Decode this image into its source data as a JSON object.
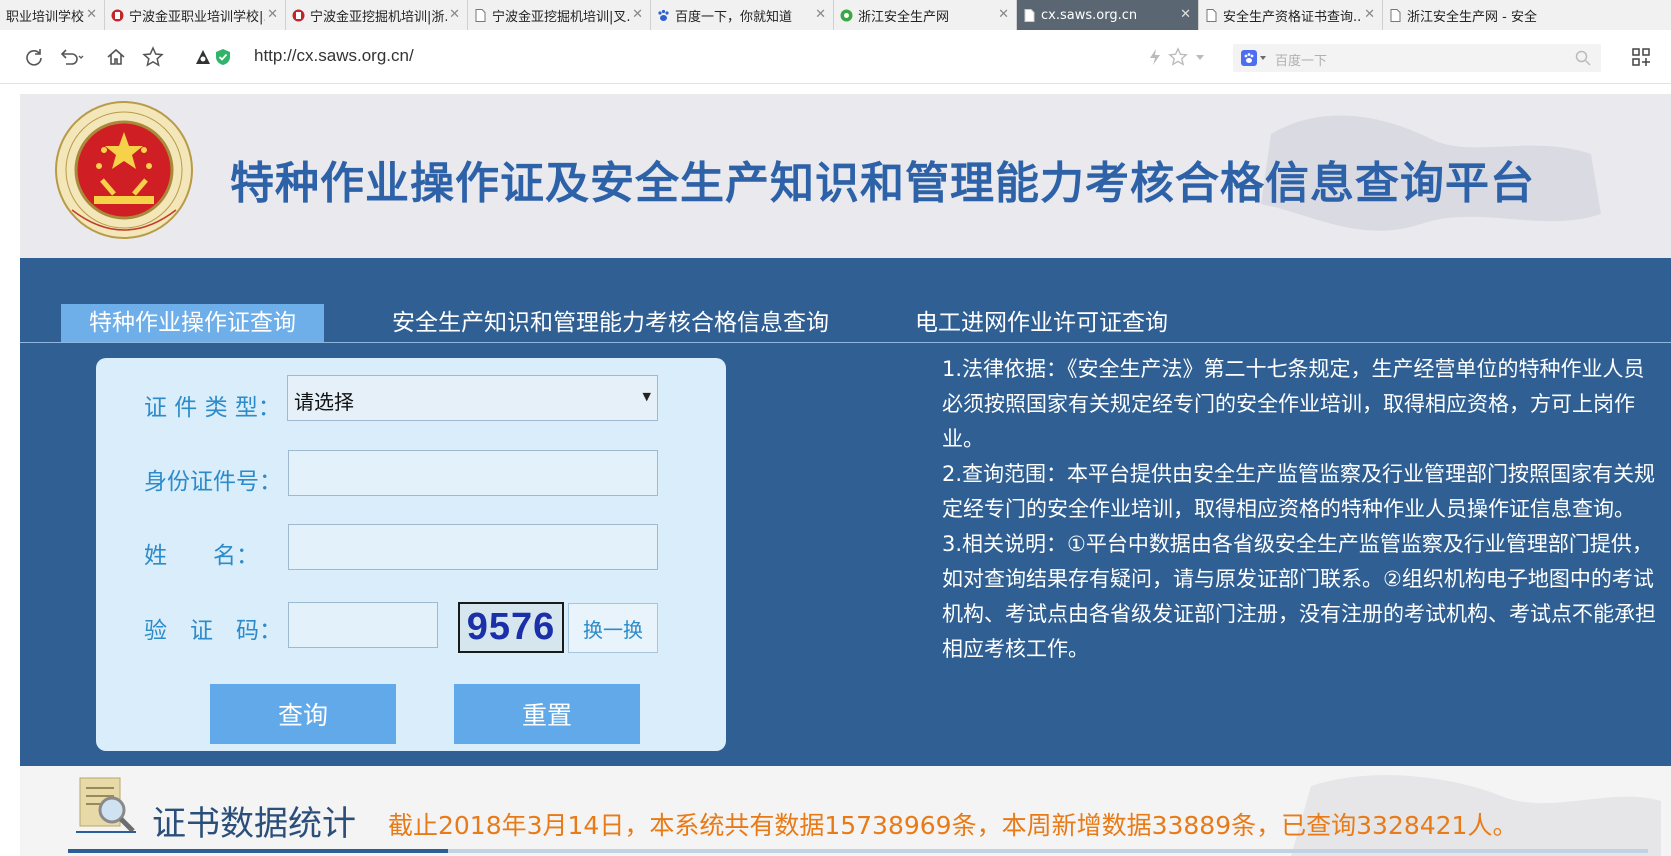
{
  "browser": {
    "tabs": [
      {
        "title": "职业培训学校|...",
        "icon": "page-icon",
        "active": false
      },
      {
        "title": "宁波金亚职业培训学校|...",
        "icon": "red-logo-icon",
        "active": false
      },
      {
        "title": "宁波金亚挖掘机培训|浙...",
        "icon": "red-logo-icon",
        "active": false
      },
      {
        "title": "宁波金亚挖掘机培训|叉...",
        "icon": "page-icon",
        "active": false
      },
      {
        "title": "百度一下，你就知道",
        "icon": "baidu-paw-icon",
        "active": false
      },
      {
        "title": "浙江安全生产网",
        "icon": "green-logo-icon",
        "active": false
      },
      {
        "title": "cx.saws.org.cn",
        "icon": "page-icon",
        "active": true
      },
      {
        "title": "安全生产资格证书查询...",
        "icon": "page-icon",
        "active": false
      },
      {
        "title": "浙江安全生产网 - 安全...",
        "icon": "page-icon",
        "active": false
      }
    ],
    "close_glyph": "✕",
    "url": "http://cx.saws.org.cn/",
    "search_placeholder": "百度一下"
  },
  "header": {
    "title": "特种作业操作证及安全生产知识和管理能力考核合格信息查询平台"
  },
  "nav": {
    "tabs": [
      {
        "label": "特种作业操作证查询",
        "active": true
      },
      {
        "label": "安全生产知识和管理能力考核合格信息查询",
        "active": false
      },
      {
        "label": "电工进网作业许可证查询",
        "active": false
      }
    ]
  },
  "form": {
    "cert_type_label": "证 件 类 型：",
    "cert_type_value": "请选择",
    "id_label": "身份证件号：",
    "id_value": "",
    "name_label": "姓　　名：",
    "name_value": "",
    "captcha_label": "验　证　码：",
    "captcha_value": "",
    "captcha_code": "9576",
    "swap_label": "换一换",
    "query_label": "查询",
    "reset_label": "重置"
  },
  "notes": [
    "1.法律依据：《安全生产法》第二十七条规定，生产经营单位的特种作业人员必须按照国家有关规定经专门的安全作业培训，取得相应资格，方可上岗作业。",
    "2.查询范围：本平台提供由安全生产监管监察及行业管理部门按照国家有关规定经专门的安全作业培训，取得相应资格的特种作业人员操作证信息查询。",
    "3.相关说明：①平台中数据由各省级安全生产监管监察及行业管理部门提供，如对查询结果存有疑问，请与原发证部门联系。②组织机构电子地图中的考试机构、考试点由各省级发证部门注册，没有注册的考试机构、考试点不能承担相应考核工作。"
  ],
  "stats": {
    "title": "证书数据统计",
    "text": "截止2018年3月14日，本系统共有数据15738969条，本周新增数据33889条，已查询3328421人。"
  },
  "colors": {
    "panel_blue": "#2f5f93",
    "active_tab": "#6eaee9",
    "title_blue": "#2e62a8",
    "stats_orange": "#e87b17",
    "label_blue": "#2d8bc9"
  }
}
